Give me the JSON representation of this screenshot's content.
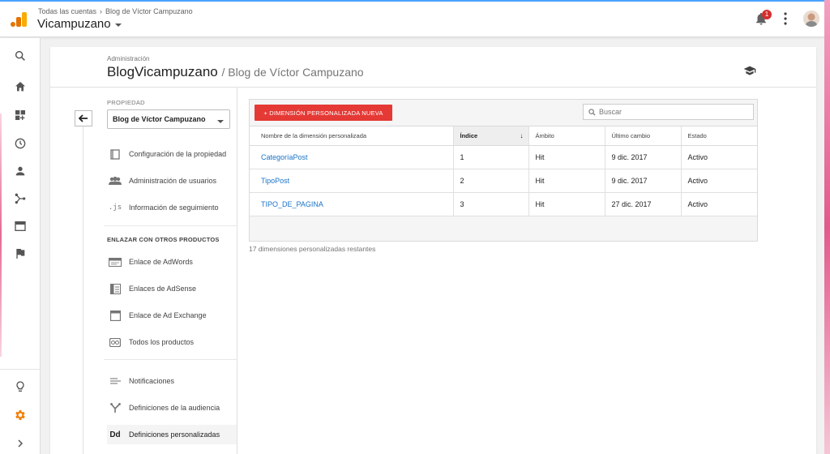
{
  "topbar": {
    "breadcrumb_root": "Todas las cuentas",
    "breadcrumb_current": "Blog de Víctor Campuzano",
    "account_name": "Vicampuzano",
    "notification_count": "1"
  },
  "header": {
    "section_label": "Administración",
    "property_name": "BlogVicampuzano",
    "view_name": "/ Blog de Víctor Campuzano"
  },
  "sidebar": {
    "property_label": "PROPIEDAD",
    "property_selected": "Blog de Víctor Campuzano",
    "items": [
      {
        "label": "Configuración de la propiedad",
        "icon": "page-icon"
      },
      {
        "label": "Administración de usuarios",
        "icon": "people-icon"
      },
      {
        "label": "Información de seguimiento",
        "icon": "js-icon"
      }
    ],
    "link_section_title": "ENLAZAR CON OTROS PRODUCTOS",
    "link_items": [
      {
        "label": "Enlace de AdWords",
        "icon": "adwords-icon"
      },
      {
        "label": "Enlaces de AdSense",
        "icon": "adsense-icon"
      },
      {
        "label": "Enlace de Ad Exchange",
        "icon": "ad-exchange-icon"
      },
      {
        "label": "Todos los productos",
        "icon": "products-icon"
      }
    ],
    "other_items": [
      {
        "label": "Notificaciones",
        "icon": "notifications-icon"
      },
      {
        "label": "Definiciones de la audiencia",
        "icon": "audience-icon"
      },
      {
        "label": "Definiciones personalizadas",
        "icon": "custom-definitions-icon",
        "active": true
      }
    ]
  },
  "main": {
    "new_button_label": "+ DIMENSIÓN PERSONALIZADA NUEVA",
    "search_placeholder": "Buscar",
    "table": {
      "columns": [
        "Nombre de la dimensión personalizada",
        "Índice",
        "Ámbito",
        "Último cambio",
        "Estado"
      ],
      "sorted_column": "Índice",
      "rows": [
        [
          "CategoríaPost",
          "1",
          "Hit",
          "9 dic. 2017",
          "Activo"
        ],
        [
          "TipoPost",
          "2",
          "Hit",
          "9 dic. 2017",
          "Activo"
        ],
        [
          "TIPO_DE_PAGINA",
          "3",
          "Hit",
          "27 dic. 2017",
          "Activo"
        ]
      ]
    },
    "remaining_text": "17 dimensiones personalizadas restantes"
  },
  "colors": {
    "accent": "#e53935",
    "link": "#1a73c8",
    "admin_gear": "#f57c00",
    "logo_orange": "#f9ab00"
  }
}
